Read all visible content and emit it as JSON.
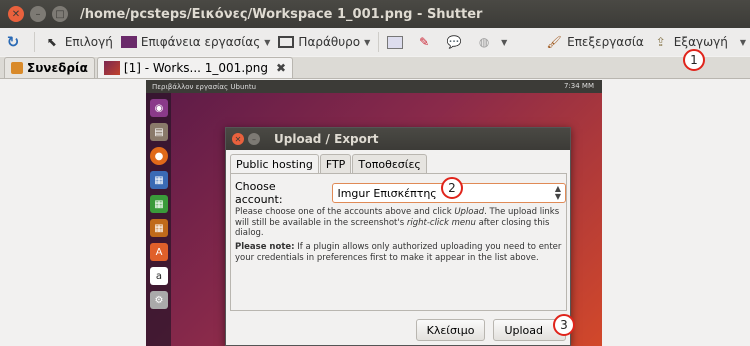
{
  "window": {
    "title": "/home/pcsteps/Εικόνες/Workspace 1_001.png - Shutter"
  },
  "toolbar": {
    "refresh_icon": "refresh-icon",
    "select_label": "Επιλογή",
    "desktop_label": "Επιφάνεια εργασίας",
    "window_label": "Παράθυρο",
    "edit_label": "Επεξεργασία",
    "export_label": "Εξαγωγή"
  },
  "tabs": {
    "session_label": "Συνεδρία",
    "file_label": "[1] - Works... 1_001.png",
    "close_glyph": "✖"
  },
  "screenshot": {
    "topbar_title": "Περιβάλλον εργασίας Ubuntu",
    "clock": "7:34 ΜΜ"
  },
  "dialog": {
    "title": "Upload / Export",
    "tabs": [
      "Public hosting",
      "FTP",
      "Τοποθεσίες"
    ],
    "account_label": "Choose account:",
    "account_value": "Imgur Επισκέπτης",
    "description_1": "Please choose one of the accounts above and click ",
    "description_upload": "Upload",
    "description_2": ". The upload links will still be available in the screenshot's ",
    "description_menu": "right-click menu",
    "description_3": " after closing this dialog.",
    "note_title": "Please note:",
    "note_text": " If a plugin allows only authorized uploading you need to enter your credentials in preferences first to make it appear in the list above.",
    "close_button": "Κλείσιμο",
    "upload_button": "Upload"
  },
  "annotations": [
    "1",
    "2",
    "3"
  ],
  "colors": {
    "accent_orange": "#e08a56",
    "annotation_red": "#e0241b",
    "close_button": "#e9613d"
  }
}
